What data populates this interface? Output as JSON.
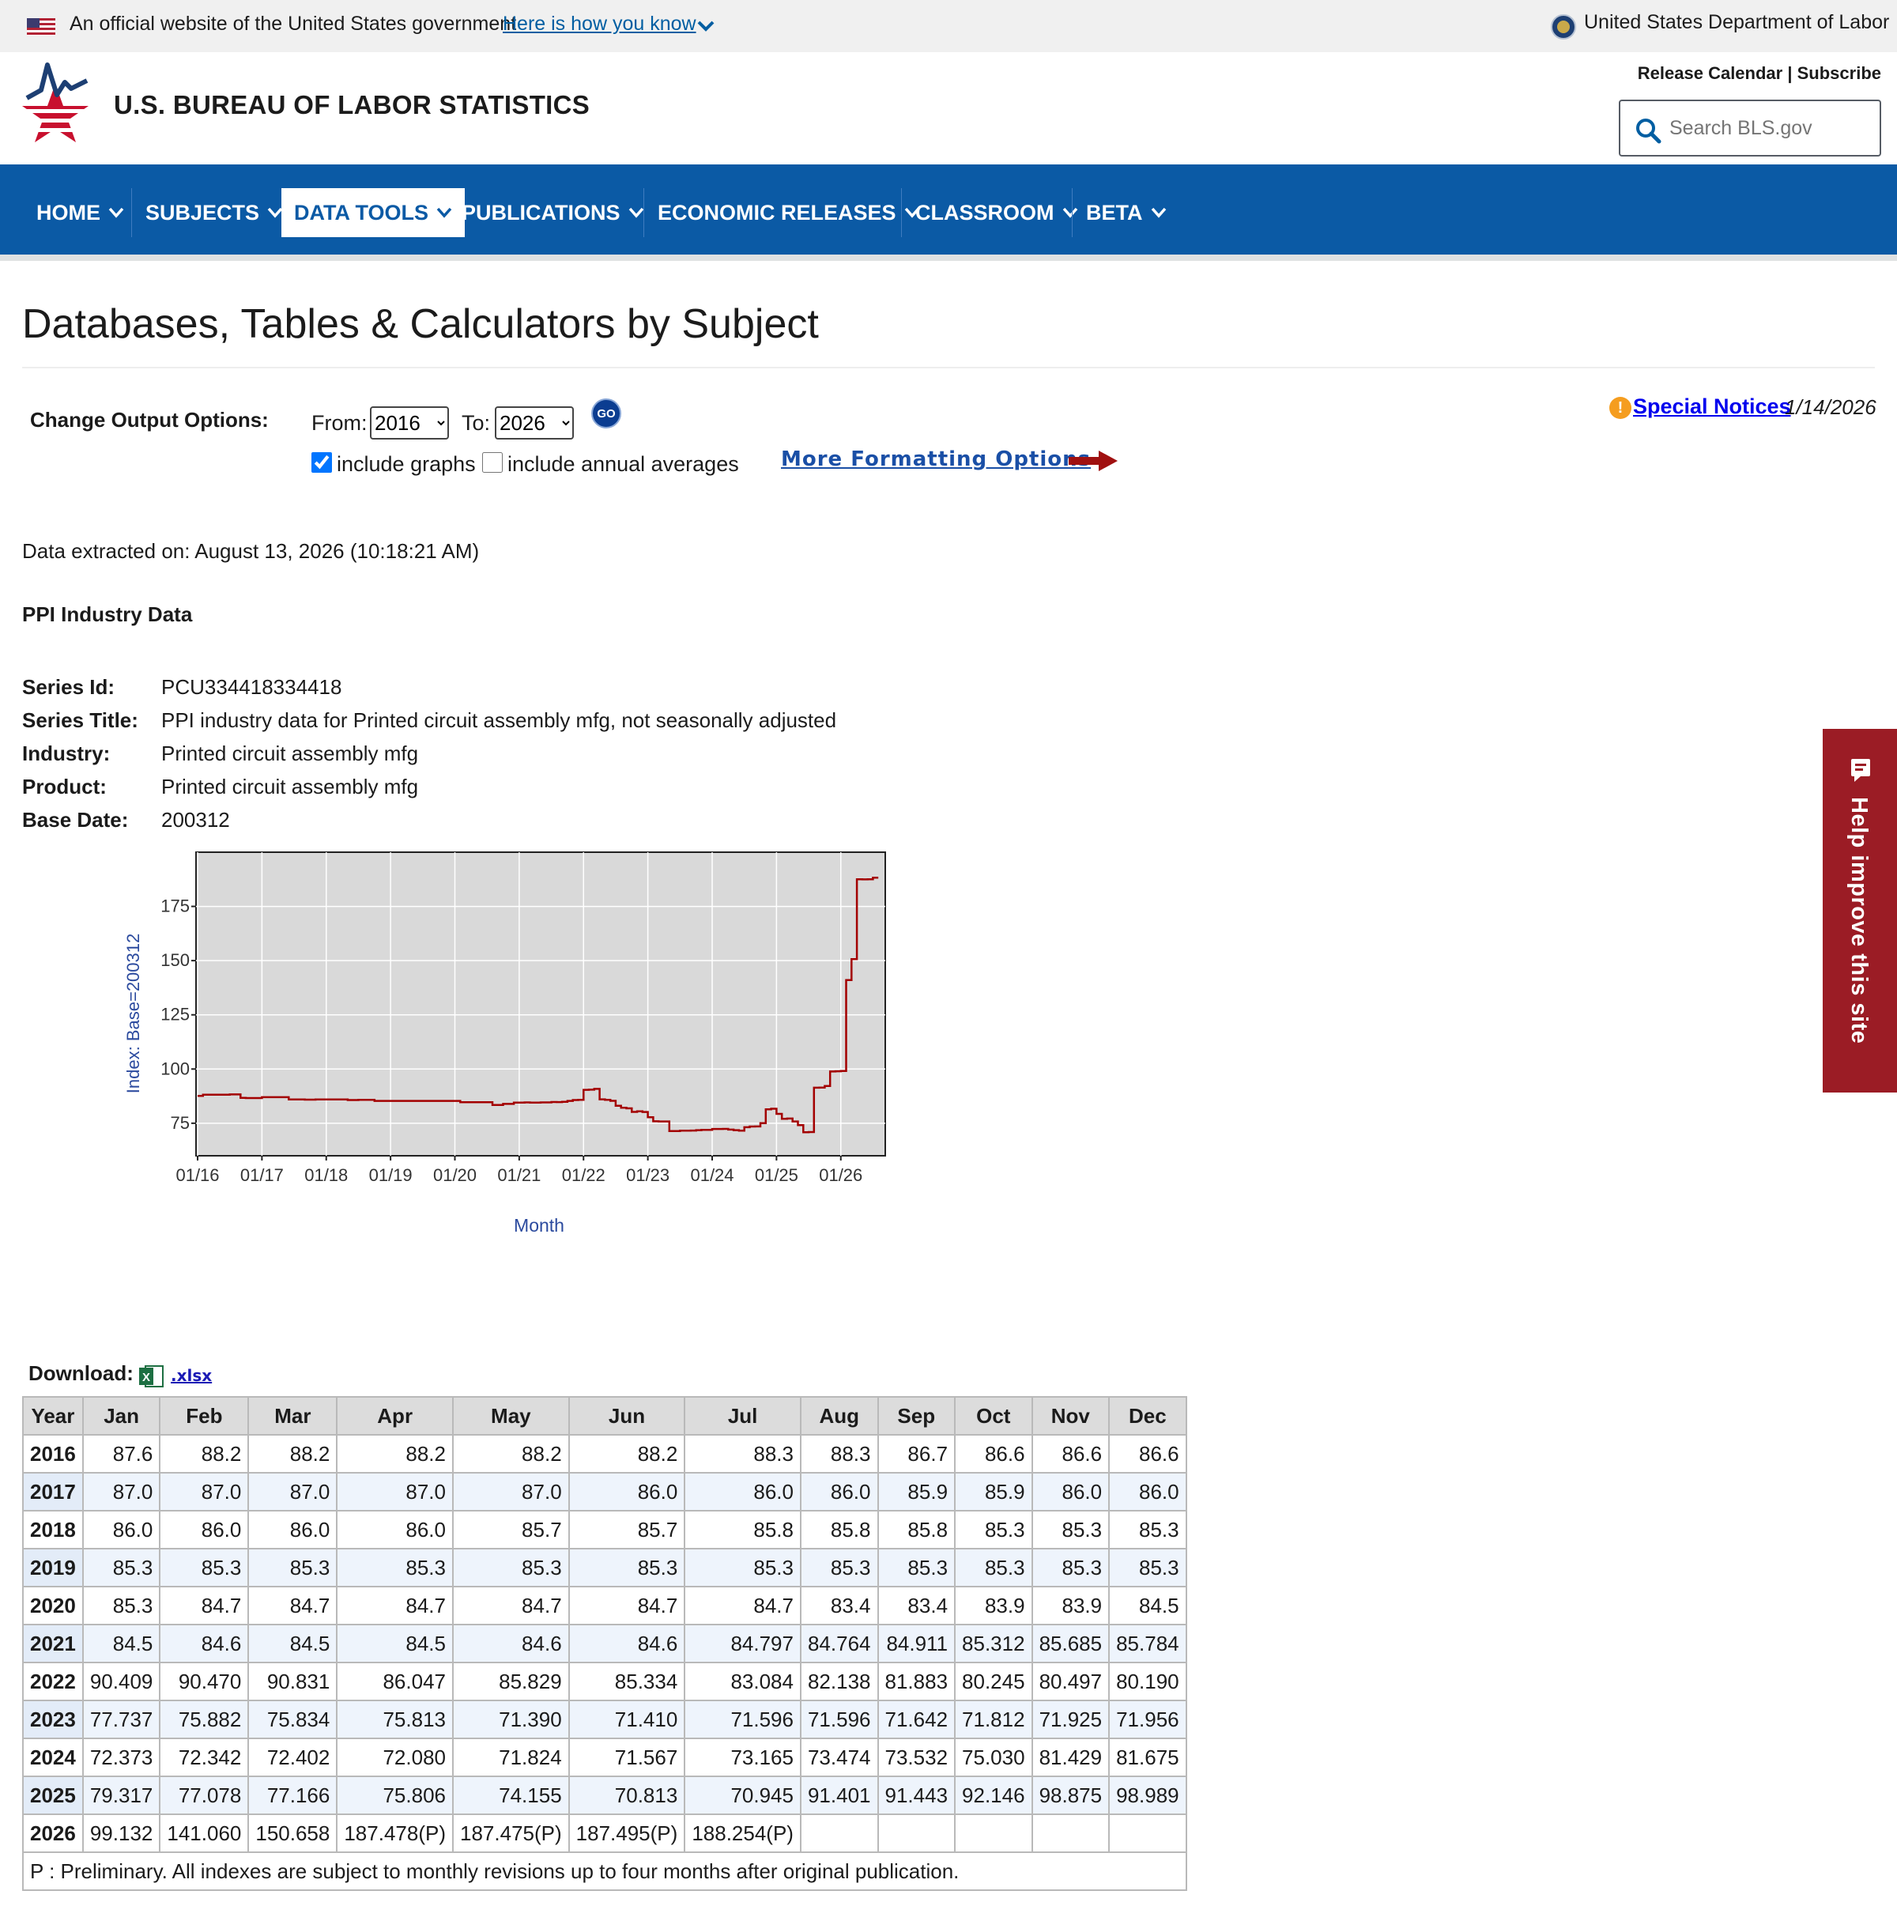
{
  "gov_banner": {
    "official_text": "An official website of the United States government",
    "how_link": "Here is how you know",
    "dol_text": "United States Department of Labor"
  },
  "header": {
    "title": "U.S. BUREAU OF LABOR STATISTICS",
    "release_calendar": "Release Calendar",
    "separator": "|",
    "subscribe": "Subscribe",
    "search_placeholder": "Search BLS.gov"
  },
  "nav": {
    "items": [
      {
        "label": "HOME"
      },
      {
        "label": "SUBJECTS"
      },
      {
        "label": "DATA TOOLS"
      },
      {
        "label": "PUBLICATIONS"
      },
      {
        "label": "ECONOMIC RELEASES"
      },
      {
        "label": "CLASSROOM"
      },
      {
        "label": "BETA"
      }
    ],
    "active": "DATA TOOLS"
  },
  "page_title": "Databases, Tables & Calculators by Subject",
  "output_options": {
    "label": "Change Output Options:",
    "from_label": "From:",
    "from_value": "2016",
    "to_label": "To:",
    "to_value": "2026",
    "go_label": "GO",
    "include_graphs_label": "include graphs",
    "include_graphs_checked": true,
    "include_annual_label": "include annual averages",
    "include_annual_checked": false,
    "more_formatting": "More Formatting Options"
  },
  "notices": {
    "link": "Special Notices",
    "date": "1/14/2026"
  },
  "extracted": "Data extracted on: August 13, 2026 (10:18:21 AM)",
  "dataset_heading": "PPI Industry Data",
  "series": [
    {
      "label": "Series Id:",
      "value": "PCU334418334418"
    },
    {
      "label": "Series Title:",
      "value": "PPI industry data for Printed circuit assembly mfg, not seasonally adjusted"
    },
    {
      "label": "Industry:",
      "value": "Printed circuit assembly mfg"
    },
    {
      "label": "Product:",
      "value": "Printed circuit assembly mfg"
    },
    {
      "label": "Base Date:",
      "value": "200312"
    }
  ],
  "chart_data": {
    "type": "line",
    "ylabel": "Index: Base=200312",
    "xlabel": "Month",
    "ylim": [
      60,
      200
    ],
    "y_ticks": [
      75,
      100,
      125,
      150,
      175
    ],
    "x_ticks": [
      "01/16",
      "01/17",
      "01/18",
      "01/19",
      "01/20",
      "01/21",
      "01/22",
      "01/23",
      "01/24",
      "01/25",
      "01/26"
    ],
    "series_color": "#a30000",
    "plot_background": "#d9d9d9",
    "grid": true,
    "start": "2016-01",
    "values": [
      87.6,
      88.2,
      88.2,
      88.2,
      88.2,
      88.2,
      88.3,
      88.3,
      86.7,
      86.6,
      86.6,
      86.6,
      87.0,
      87.0,
      87.0,
      87.0,
      87.0,
      86.0,
      86.0,
      86.0,
      85.9,
      85.9,
      86.0,
      86.0,
      86.0,
      86.0,
      86.0,
      86.0,
      85.7,
      85.7,
      85.8,
      85.8,
      85.8,
      85.3,
      85.3,
      85.3,
      85.3,
      85.3,
      85.3,
      85.3,
      85.3,
      85.3,
      85.3,
      85.3,
      85.3,
      85.3,
      85.3,
      85.3,
      85.3,
      84.7,
      84.7,
      84.7,
      84.7,
      84.7,
      84.7,
      83.4,
      83.4,
      83.9,
      83.9,
      84.5,
      84.5,
      84.6,
      84.5,
      84.5,
      84.6,
      84.6,
      84.797,
      84.764,
      84.911,
      85.312,
      85.685,
      85.784,
      90.409,
      90.47,
      90.831,
      86.047,
      85.829,
      85.334,
      83.084,
      82.138,
      81.883,
      80.245,
      80.497,
      80.19,
      77.737,
      75.882,
      75.834,
      75.813,
      71.39,
      71.41,
      71.596,
      71.596,
      71.642,
      71.812,
      71.925,
      71.956,
      72.373,
      72.342,
      72.402,
      72.08,
      71.824,
      71.567,
      73.165,
      73.474,
      73.532,
      75.03,
      81.429,
      81.675,
      79.317,
      77.078,
      77.166,
      75.806,
      74.155,
      70.813,
      70.945,
      91.401,
      91.443,
      92.146,
      98.875,
      98.989,
      99.132,
      141.06,
      150.658,
      187.478,
      187.475,
      187.495,
      188.254
    ]
  },
  "download": {
    "label": "Download:",
    "link": ".xlsx"
  },
  "table": {
    "headers": [
      "Year",
      "Jan",
      "Feb",
      "Mar",
      "Apr",
      "May",
      "Jun",
      "Jul",
      "Aug",
      "Sep",
      "Oct",
      "Nov",
      "Dec"
    ],
    "rows": [
      [
        "2016",
        "87.6",
        "88.2",
        "88.2",
        "88.2",
        "88.2",
        "88.2",
        "88.3",
        "88.3",
        "86.7",
        "86.6",
        "86.6",
        "86.6"
      ],
      [
        "2017",
        "87.0",
        "87.0",
        "87.0",
        "87.0",
        "87.0",
        "86.0",
        "86.0",
        "86.0",
        "85.9",
        "85.9",
        "86.0",
        "86.0"
      ],
      [
        "2018",
        "86.0",
        "86.0",
        "86.0",
        "86.0",
        "85.7",
        "85.7",
        "85.8",
        "85.8",
        "85.8",
        "85.3",
        "85.3",
        "85.3"
      ],
      [
        "2019",
        "85.3",
        "85.3",
        "85.3",
        "85.3",
        "85.3",
        "85.3",
        "85.3",
        "85.3",
        "85.3",
        "85.3",
        "85.3",
        "85.3"
      ],
      [
        "2020",
        "85.3",
        "84.7",
        "84.7",
        "84.7",
        "84.7",
        "84.7",
        "84.7",
        "83.4",
        "83.4",
        "83.9",
        "83.9",
        "84.5"
      ],
      [
        "2021",
        "84.5",
        "84.6",
        "84.5",
        "84.5",
        "84.6",
        "84.6",
        "84.797",
        "84.764",
        "84.911",
        "85.312",
        "85.685",
        "85.784"
      ],
      [
        "2022",
        "90.409",
        "90.470",
        "90.831",
        "86.047",
        "85.829",
        "85.334",
        "83.084",
        "82.138",
        "81.883",
        "80.245",
        "80.497",
        "80.190"
      ],
      [
        "2023",
        "77.737",
        "75.882",
        "75.834",
        "75.813",
        "71.390",
        "71.410",
        "71.596",
        "71.596",
        "71.642",
        "71.812",
        "71.925",
        "71.956"
      ],
      [
        "2024",
        "72.373",
        "72.342",
        "72.402",
        "72.080",
        "71.824",
        "71.567",
        "73.165",
        "73.474",
        "73.532",
        "75.030",
        "81.429",
        "81.675"
      ],
      [
        "2025",
        "79.317",
        "77.078",
        "77.166",
        "75.806",
        "74.155",
        "70.813",
        "70.945",
        "91.401",
        "91.443",
        "92.146",
        "98.875",
        "98.989"
      ],
      [
        "2026",
        "99.132",
        "141.060",
        "150.658",
        "187.478(P)",
        "187.475(P)",
        "187.495(P)",
        "188.254(P)",
        "",
        "",
        "",
        "",
        ""
      ]
    ],
    "footnote": "P : Preliminary. All indexes are subject to monthly revisions up to four months after original publication."
  },
  "feedback": {
    "label": "Help improve this site"
  }
}
